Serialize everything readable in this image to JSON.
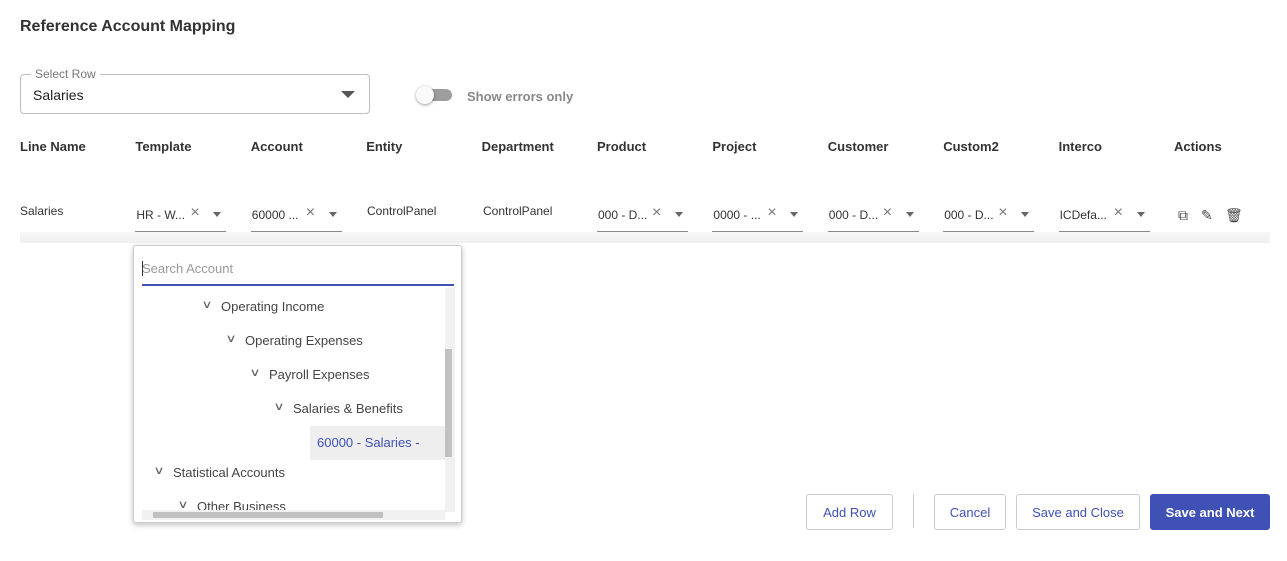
{
  "title": "Reference Account Mapping",
  "select_row": {
    "label": "Select Row",
    "value": "Salaries"
  },
  "toggle": {
    "label": "Show errors only",
    "on": false
  },
  "columns": [
    "Line Name",
    "Template",
    "Account",
    "Entity",
    "Department",
    "Product",
    "Project",
    "Customer",
    "Custom2",
    "Interco",
    "Actions"
  ],
  "row": {
    "line_name": "Salaries",
    "template": "HR - W...",
    "account": "60000 ...",
    "entity": "ControlPanel",
    "department": "ControlPanel",
    "product": "000 - D...",
    "project": "0000 - ...",
    "customer": "000 - D...",
    "custom2": "000 - D...",
    "interco": "ICDefa..."
  },
  "dropdown": {
    "placeholder": "Search Account",
    "items": [
      {
        "label": "Operating Income",
        "level": 3
      },
      {
        "label": "Operating Expenses",
        "level": 4
      },
      {
        "label": "Payroll Expenses",
        "level": 5
      },
      {
        "label": "Salaries & Benefits",
        "level": 6
      },
      {
        "label": "60000 - Salaries -",
        "level": 7,
        "selected": true
      },
      {
        "label": "Statistical Accounts",
        "level": 1
      },
      {
        "label": "Other Business",
        "level": 2
      }
    ]
  },
  "buttons": {
    "add_row": "Add Row",
    "cancel": "Cancel",
    "save_close": "Save and Close",
    "save_next": "Save and Next"
  },
  "colors": {
    "accent": "#3f51b5"
  }
}
